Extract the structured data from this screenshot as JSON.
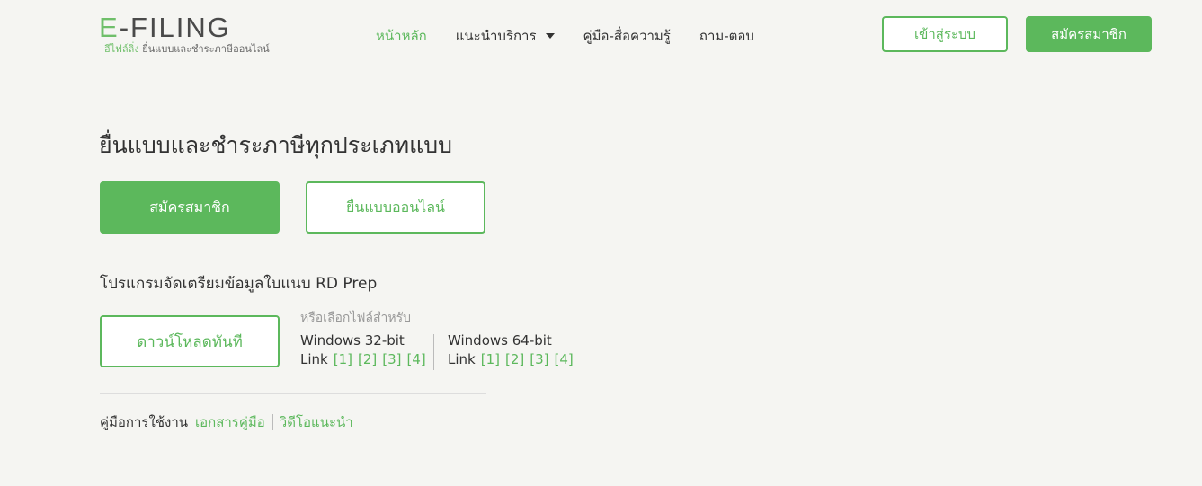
{
  "header": {
    "logo": {
      "e": "E",
      "rest": "-FILING",
      "subtitle_green": "อีไฟล์ลิ่ง",
      "subtitle": "ยื่นแบบและชำระภาษีออนไลน์"
    },
    "nav": [
      {
        "label": "หน้าหลัก",
        "active": true
      },
      {
        "label": "แนะนำบริการ",
        "dropdown": true
      },
      {
        "label": "คู่มือ-สื่อความรู้"
      },
      {
        "label": "ถาม-ตอบ"
      }
    ],
    "login_label": "เข้าสู่ระบบ",
    "signup_label": "สมัครสมาชิก"
  },
  "main": {
    "title": "ยื่นแบบและชำระภาษีทุกประเภทแบบ",
    "signup_label": "สมัครสมาชิก",
    "file_online_label": "ยื่นแบบออนไลน์",
    "rdprep_title": "โปรแกรมจัดเตรียมข้อมูลใบแนบ RD Prep",
    "download_label": "ดาวน์โหลดทันที",
    "choose_label": "หรือเลือกไฟล์สำหรับ",
    "windows": [
      {
        "name": "Windows 32-bit",
        "link_label": "Link",
        "links": [
          "[1]",
          "[2]",
          "[3]",
          "[4]"
        ]
      },
      {
        "name": "Windows 64-bit",
        "link_label": "Link",
        "links": [
          "[1]",
          "[2]",
          "[3]",
          "[4]"
        ]
      }
    ],
    "manual": {
      "label": "คู่มือการใช้งาน",
      "doc_link": "เอกสารคู่มือ",
      "video_link": "วิดีโอแนะนำ"
    }
  },
  "colors": {
    "accent": "#5cb85c",
    "background": "#f5f5f2",
    "text": "#333333"
  }
}
